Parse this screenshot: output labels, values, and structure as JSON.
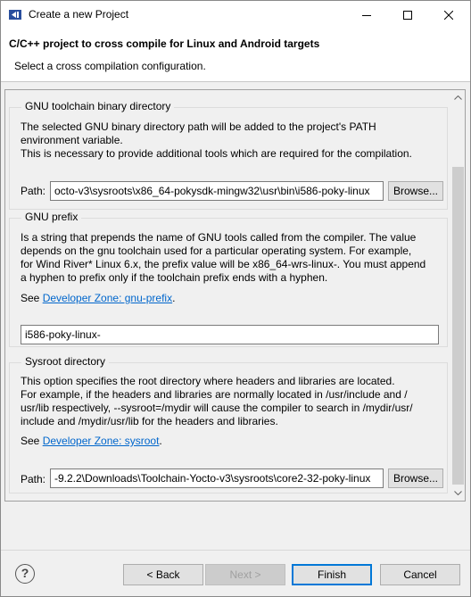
{
  "window": {
    "title": "Create a new Project",
    "controls": {
      "minimize": "minimize-icon",
      "maximize": "maximize-icon",
      "close": "close-icon"
    }
  },
  "header": {
    "title": "C/C++ project to cross compile for Linux and Android targets",
    "subtitle": "Select a cross compilation configuration."
  },
  "toolchain": {
    "title": "GNU toolchain binary directory",
    "description_lines": [
      "The selected GNU binary directory path will be added to the project's PATH",
      "environment variable.",
      "This is necessary to provide additional tools which are required for the compilation."
    ],
    "path_label": "Path:",
    "path_value": "octo-v3\\sysroots\\x86_64-pokysdk-mingw32\\usr\\bin\\i586-poky-linux",
    "browse_label": "Browse..."
  },
  "prefix": {
    "title": "GNU prefix",
    "description_lines": [
      "Is a string that prepends the name of GNU tools called from the compiler. The value",
      "depends on the gnu toolchain used for a particular operating system. For example,",
      "for Wind River* Linux 6.x, the prefix value will be x86_64-wrs-linux-. You must append",
      "a hyphen to prefix only if the toolchain prefix ends with a hyphen."
    ],
    "see_prefix": "See ",
    "link_text": "Developer Zone: gnu-prefix",
    "see_suffix": ".",
    "value": "i586-poky-linux-"
  },
  "sysroot": {
    "title": "Sysroot directory",
    "description_lines": [
      "This option specifies the root directory where headers and libraries are located.",
      "For example, if the headers and libraries are normally located in /usr/include and /",
      "usr/lib respectively, --sysroot=/mydir will cause the compiler to search in /mydir/usr/",
      "include and /mydir/usr/lib for the headers and libraries."
    ],
    "see_prefix": "See ",
    "link_text": "Developer Zone: sysroot",
    "see_suffix": ".",
    "path_label": "Path:",
    "path_value": "-9.2.2\\Downloads\\Toolchain-Yocto-v3\\sysroots\\core2-32-poky-linux",
    "browse_label": "Browse..."
  },
  "footer": {
    "help": "?",
    "back": "< Back",
    "next": "Next >",
    "finish": "Finish",
    "cancel": "Cancel"
  },
  "colors": {
    "link": "#0066cc",
    "default_button_border": "#0078d7"
  }
}
